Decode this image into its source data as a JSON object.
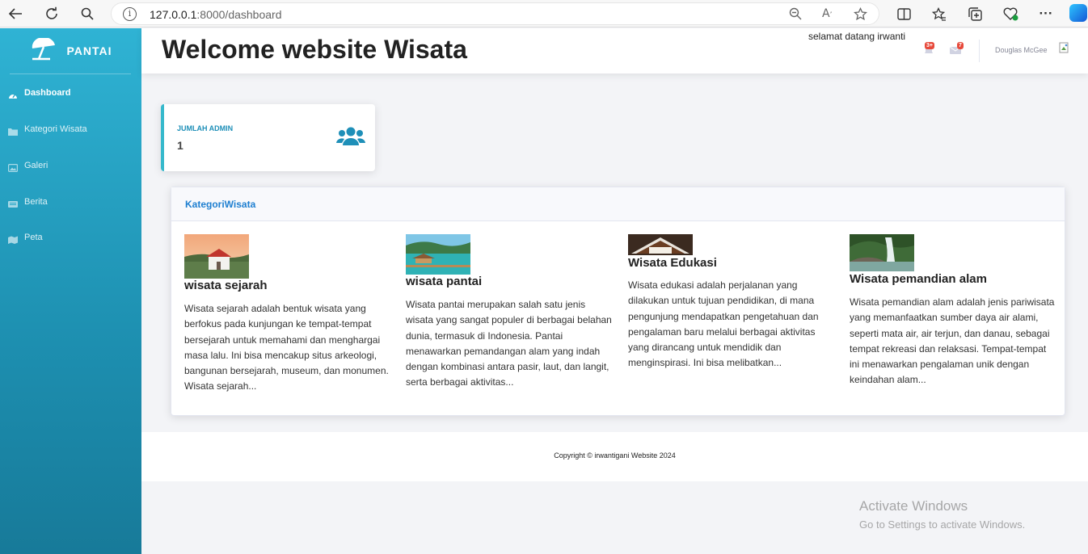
{
  "browser": {
    "url_host": "127.0.0.1",
    "url_rest": ":8000/dashboard"
  },
  "sidebar": {
    "brand": "PANTAI",
    "items": [
      {
        "label": "Dashboard",
        "icon": "tachometer-icon",
        "active": true
      },
      {
        "label": "Kategori Wisata",
        "icon": "folder-icon",
        "active": false
      },
      {
        "label": "Galeri",
        "icon": "images-icon",
        "active": false
      },
      {
        "label": "Berita",
        "icon": "newspaper-icon",
        "active": false
      },
      {
        "label": "Peta",
        "icon": "map-icon",
        "active": false
      }
    ]
  },
  "topbar": {
    "title": "Welcome website Wisata",
    "welcome": "selamat datang irwanti",
    "alerts_badge": "3+",
    "messages_badge": "7",
    "user_name": "Douglas McGee"
  },
  "stat": {
    "label": "JUMLAH ADMIN",
    "value": "1"
  },
  "kategori": {
    "title": "KategoriWisata",
    "items": [
      {
        "name": "wisata sejarah",
        "desc": "Wisata sejarah adalah bentuk wisata yang berfokus pada kunjungan ke tempat-tempat bersejarah untuk memahami dan menghargai masa lalu. Ini bisa mencakup situs arkeologi, bangunan bersejarah, museum, dan monumen. Wisata sejarah..."
      },
      {
        "name": "wisata pantai",
        "desc": "Wisata pantai merupakan salah satu jenis wisata yang sangat populer di berbagai belahan dunia, termasuk di Indonesia. Pantai menawarkan pemandangan alam yang indah dengan kombinasi antara pasir, laut, dan langit, serta berbagai aktivitas..."
      },
      {
        "name": "Wisata Edukasi",
        "desc": "Wisata edukasi adalah perjalanan yang dilakukan untuk tujuan pendidikan, di mana pengunjung mendapatkan pengetahuan dan pengalaman baru melalui berbagai aktivitas yang dirancang untuk mendidik dan menginspirasi. Ini bisa melibatkan..."
      },
      {
        "name": "Wisata pemandian alam",
        "desc": "Wisata pemandian alam adalah jenis pariwisata yang memanfaatkan sumber daya air alami, seperti mata air, air terjun, dan danau, sebagai tempat rekreasi dan relaksasi. Tempat-tempat ini menawarkan pengalaman unik dengan keindahan alam..."
      }
    ]
  },
  "footer": {
    "copyright": "Copyright © irwantigani Website 2024"
  },
  "watermark": {
    "line1": "Activate Windows",
    "line2": "Go to Settings to activate Windows."
  },
  "colors": {
    "sidebar_top": "#2fb3d4",
    "sidebar_bottom": "#177a99",
    "accent": "#36b9cc",
    "link": "#1e7fd0",
    "badge": "#e74a3b"
  }
}
